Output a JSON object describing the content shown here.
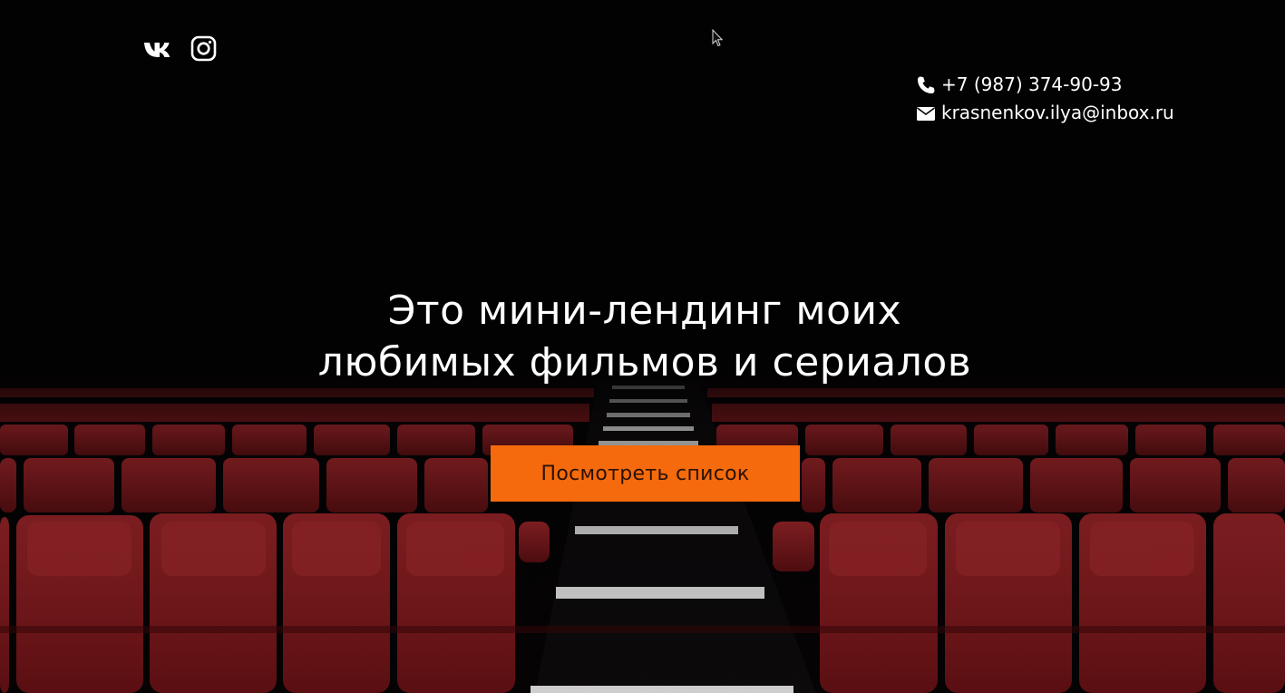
{
  "social": {
    "vk_icon": "vk-icon",
    "instagram_icon": "instagram-icon"
  },
  "contacts": {
    "phone": "+7 (987) 374-90-93",
    "phone_icon": "phone-icon",
    "email": "krasnenkov.ilya@inbox.ru",
    "email_icon": "envelope-icon"
  },
  "hero": {
    "headline_line1": "Это мини-лендинг моих",
    "headline_line2": "любимых фильмов и сериалов",
    "cta_label": "Посмотреть список"
  },
  "colors": {
    "accent": "#f46a0c",
    "seat_red": "#8e1b1e",
    "background": "#050304",
    "text": "#ffffff"
  }
}
